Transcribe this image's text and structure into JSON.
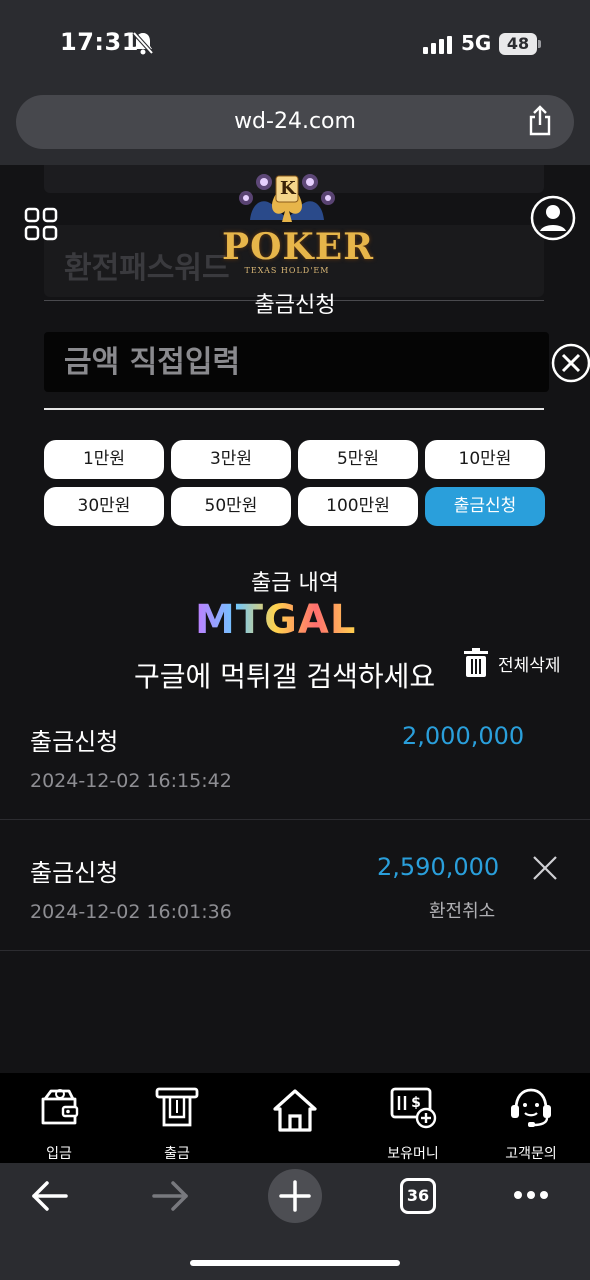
{
  "status_bar": {
    "time": "17:31",
    "network": "5G",
    "battery": "48"
  },
  "browser": {
    "url": "wd-24.com",
    "tab_count": "36"
  },
  "logo": {
    "word": "POKER",
    "subtitle": "TEXAS HOLD'EM",
    "badge": "K"
  },
  "ghost": {
    "password_placeholder": "환전패스워드"
  },
  "form": {
    "title": "출금신청",
    "amount_placeholder": "금액 직접입력",
    "buttons": [
      "1만원",
      "3만원",
      "5만원",
      "10만원",
      "30만원",
      "50만원",
      "100만원"
    ],
    "submit_label": "출금신청"
  },
  "history": {
    "title": "출금 내역",
    "delete_all": "전체삭제",
    "records": [
      {
        "title": "출금신청",
        "date": "2024-12-02 16:15:42",
        "amount": "2,000,000",
        "status": ""
      },
      {
        "title": "출금신청",
        "date": "2024-12-02 16:01:36",
        "amount": "2,590,000",
        "status": "환전취소"
      }
    ]
  },
  "watermark": {
    "logo": "MTGAL",
    "text": "구글에 먹튀갤 검색하세요"
  },
  "tabbar": [
    {
      "label": "입금",
      "icon": "wallet-icon"
    },
    {
      "label": "출금",
      "icon": "atm-icon"
    },
    {
      "label": "",
      "icon": "home-icon"
    },
    {
      "label": "보유머니",
      "icon": "money-icon"
    },
    {
      "label": "고객문의",
      "icon": "headset-icon"
    }
  ],
  "colors": {
    "accent": "#2a9fdb",
    "background": "#131315",
    "chrome": "#2b2c30"
  }
}
